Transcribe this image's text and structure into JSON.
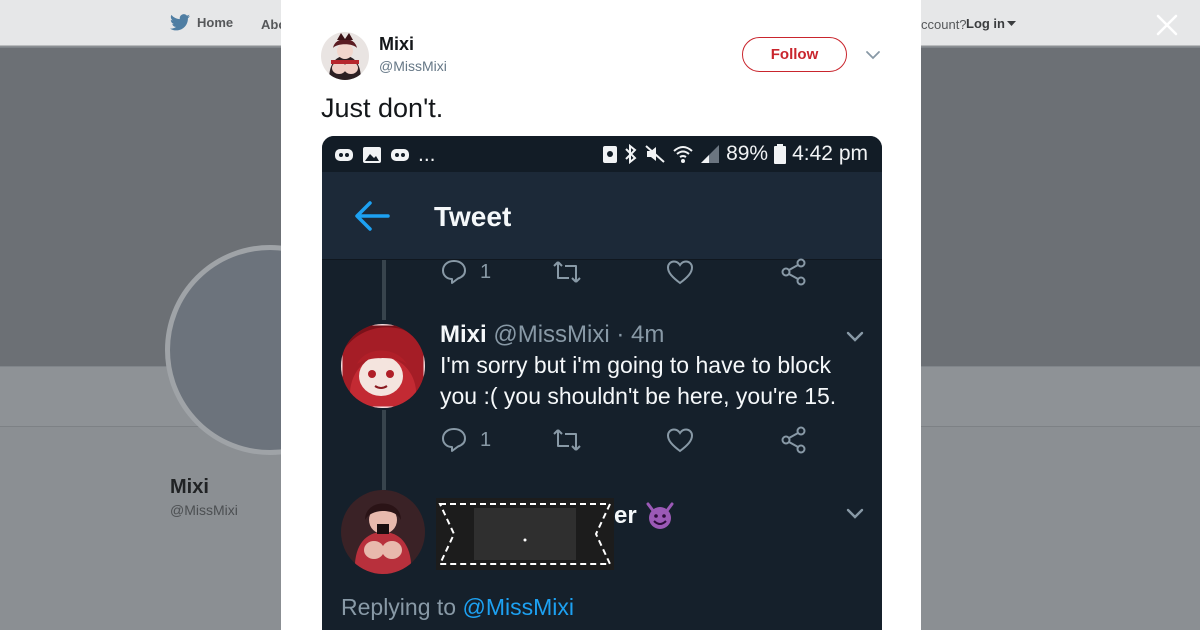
{
  "background": {
    "nav": {
      "home_label": "Home",
      "about_label": "Abo",
      "account_label": "ccount?",
      "login_label": "Log in"
    },
    "profile": {
      "name": "Mixi",
      "handle": "@MissMixi"
    }
  },
  "modal": {
    "author": {
      "name": "Mixi",
      "handle": "@MissMixi"
    },
    "follow_label": "Follow",
    "tweet_text": "Just don't."
  },
  "screenshot": {
    "status_bar": {
      "left_more": "...",
      "battery": "89%",
      "time": "4:42 pm"
    },
    "app_bar_title": "Tweet",
    "first_reply_count": "1",
    "tweet": {
      "name": "Mixi",
      "handle": "@MissMixi",
      "time": "· 4m",
      "body": "I'm sorry but i'm going to have to block you :( you shouldn't be here, you're 15.",
      "reply_count": "1"
    },
    "next_tweet": {
      "partial_name": "er",
      "emoji": "devil-face-emoji"
    },
    "replying_prefix": "Replying to",
    "replying_mention": "@MissMixi"
  },
  "colors": {
    "follow_accent": "#c9252d",
    "twitter_blue": "#1da1f2",
    "dark_bg": "#15202b",
    "dark_appbar": "#1c2938"
  }
}
